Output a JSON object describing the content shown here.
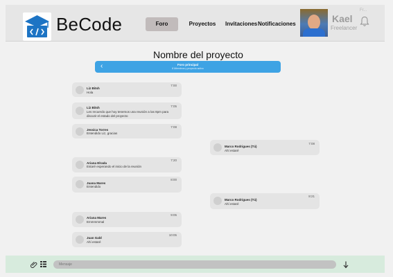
{
  "app": {
    "brand": "BeCode"
  },
  "nav": [
    {
      "label": "Foro",
      "active": true
    },
    {
      "label": "Proyectos"
    },
    {
      "label": "Invitaciones"
    },
    {
      "label": "Notificaciones"
    }
  ],
  "user": {
    "name": "Kael",
    "role": "Freelancer",
    "truncated": "Fr..."
  },
  "page": {
    "title": "Nombre del proyecto"
  },
  "thread": {
    "title": "Foro principal",
    "subtitle": "8 Miembros y proyecto activo"
  },
  "messages": [
    {
      "author": "Liz Bitsh",
      "text": "Hola",
      "time": "7:00",
      "side": "left"
    },
    {
      "author": "Liz Bitsh",
      "text": "Les recuerdo que hoy tenemos una reunión a las 8pm para discutir el estado del proyecto",
      "time": "7:05",
      "side": "left"
    },
    {
      "author": "Jessica Torres",
      "text": "Entendido Liz, gracias",
      "time": "7:08",
      "side": "left"
    },
    {
      "author": "Marco Rodrigues (Tú)",
      "text": "Ahí estaré",
      "time": "7:08",
      "side": "right"
    },
    {
      "author": "Ariana Elrada",
      "text": "Estaré esperando el inicio de la reunión",
      "time": "7:20",
      "side": "left"
    },
    {
      "author": "Juana Mares",
      "text": "Entendido",
      "time": "8:00",
      "side": "left"
    },
    {
      "author": "Marco Rodrigues (Tú)",
      "text": "Ahí estaré",
      "time": "8:21",
      "side": "right"
    },
    {
      "author": "Ariana Mares",
      "text": "Emmmmmal",
      "time": "9:05",
      "side": "left"
    },
    {
      "author": "Juan Gald",
      "text": "Ahí estaré",
      "time": "10:05",
      "side": "left"
    }
  ],
  "composer": {
    "placeholder": "Mensaje"
  },
  "icons": {
    "logo": "graduation-cap-code-icon",
    "bell": "bell-icon",
    "back": "chevron-left-icon",
    "attach": "paperclip-icon",
    "apps": "grid-icon",
    "send": "send-icon"
  },
  "colors": {
    "accent": "#3ea3e4",
    "active_nav": "#c1bbbb",
    "composer_bg": "#d7ebdd",
    "logo_blue": "#1d74c4"
  }
}
